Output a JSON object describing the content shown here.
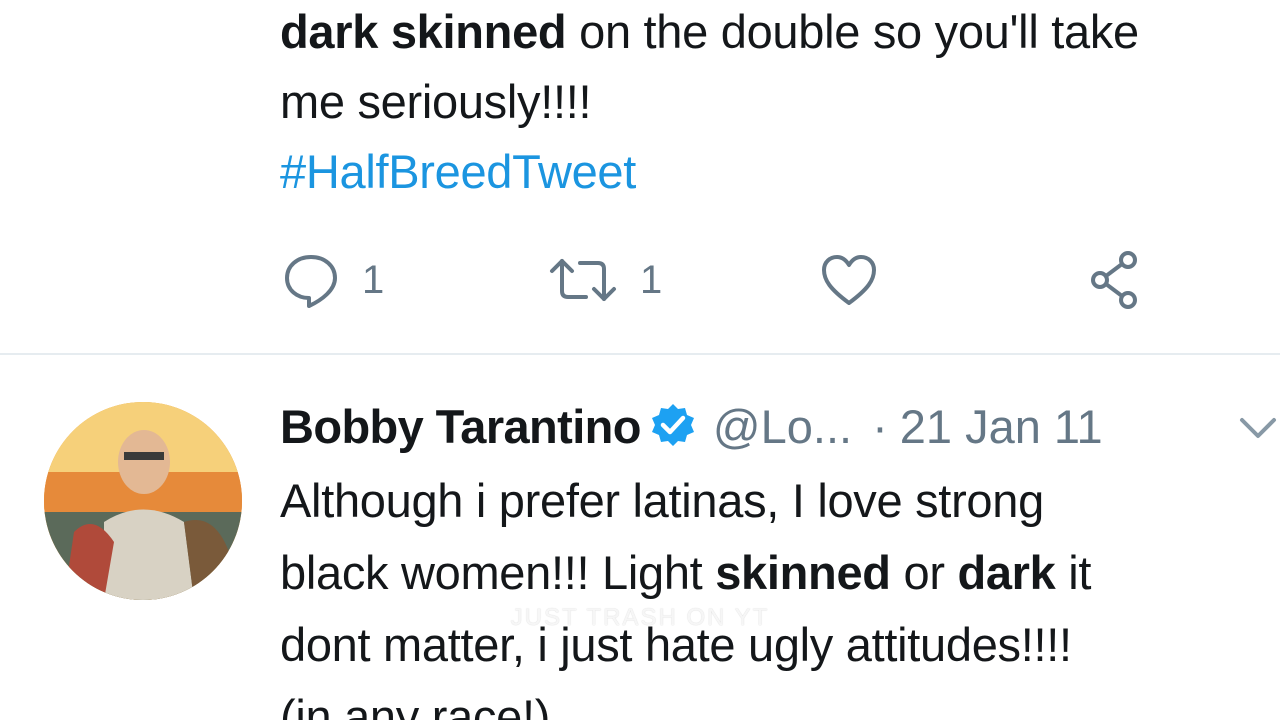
{
  "tweet_top": {
    "line1_bold": "dark skinned",
    "line1_rest": " on the double so you'll take",
    "line2": "me seriously!!!!",
    "hashtag": "#HalfBreedTweet",
    "actions": {
      "reply_icon": "reply-icon",
      "reply_count": "1",
      "retweet_icon": "retweet-icon",
      "retweet_count": "1",
      "like_icon": "heart-icon",
      "share_icon": "share-icon"
    }
  },
  "tweet_second": {
    "avatar_icon": "avatar",
    "name": "Bobby Tarantino",
    "verified_icon": "verified-badge-icon",
    "handle": "@Lo...",
    "separator": "·",
    "date": "21 Jan 11",
    "menu_icon": "chevron-down-icon",
    "text": {
      "p1": "Although i prefer latinas, I love strong",
      "p2": "black women!!! Light ",
      "b1": "skinned",
      "p3": " or ",
      "b2": "dark",
      "p4": " it",
      "p5": "dont matter, i just hate ugly attitudes!!!!",
      "p6": "(in any race!)"
    }
  },
  "watermark": "JUST TRASH ON YT",
  "colors": {
    "link": "#1b95e0",
    "secondary": "#657786",
    "divider": "#e6ecf0",
    "verified": "#1da1f2"
  }
}
